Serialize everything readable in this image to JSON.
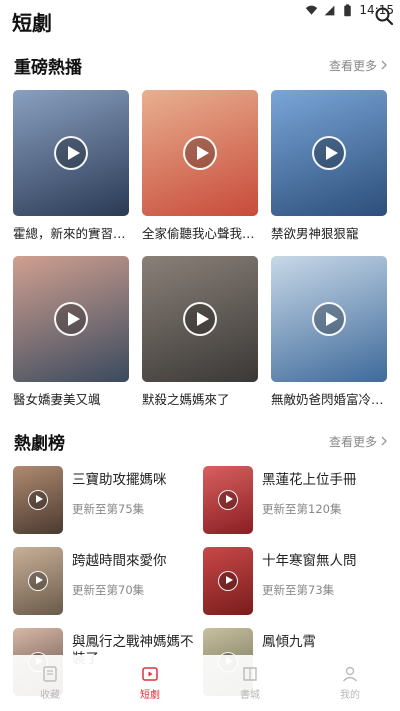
{
  "status": {
    "time": "14:15"
  },
  "header": {
    "title": "短劇"
  },
  "hot_section": {
    "title": "重磅熱播",
    "see_more": "查看更多",
    "items": [
      {
        "title": "霍總，新來的實習生又哭了",
        "colors": [
          "#2a3a55",
          "#8aa0c0"
        ]
      },
      {
        "title": "全家偷聽我心聲我殺瘋了",
        "colors": [
          "#c84a3a",
          "#e8b090"
        ]
      },
      {
        "title": "禁欲男神狠狠寵",
        "colors": [
          "#2c4e7a",
          "#7aa6d8"
        ]
      },
      {
        "title": "醫女嬌妻美又颯",
        "colors": [
          "#3a4a5e",
          "#d0a090"
        ]
      },
      {
        "title": "默殺之媽媽來了",
        "colors": [
          "#3a3836",
          "#8a8078"
        ]
      },
      {
        "title": "無敵奶爸閃婚富冷總裁",
        "colors": [
          "#3e6a9a",
          "#c8d8e8"
        ]
      }
    ]
  },
  "rank_section": {
    "title": "熱劇榜",
    "see_more": "查看更多",
    "items": [
      {
        "name": "三寶助攻擺媽咪",
        "sub": "更新至第75集",
        "colors": [
          "#4a3a30",
          "#b08a70"
        ]
      },
      {
        "name": "黑蓮花上位手冊",
        "sub": "更新至第120集",
        "colors": [
          "#8a1e22",
          "#d86060"
        ]
      },
      {
        "name": "跨越時間來愛你",
        "sub": "更新至第70集",
        "colors": [
          "#6a5a4a",
          "#c8b098"
        ]
      },
      {
        "name": "十年寒窗無人問",
        "sub": "更新至第73集",
        "colors": [
          "#7a1c1c",
          "#c84848"
        ]
      },
      {
        "name": "與鳳行之戰神媽媽不裝了",
        "sub": "",
        "colors": [
          "#5a4a42",
          "#d8b8a8"
        ]
      },
      {
        "name": "鳳傾九霄",
        "sub": "",
        "colors": [
          "#6a6a50",
          "#c8c0a0"
        ]
      }
    ]
  },
  "tabs": [
    {
      "label": "收藏",
      "icon": "bookmark-icon",
      "active": false
    },
    {
      "label": "短劇",
      "icon": "play-box-icon",
      "active": true
    },
    {
      "label": "書城",
      "icon": "book-icon",
      "active": false
    },
    {
      "label": "我的",
      "icon": "person-icon",
      "active": false
    }
  ]
}
